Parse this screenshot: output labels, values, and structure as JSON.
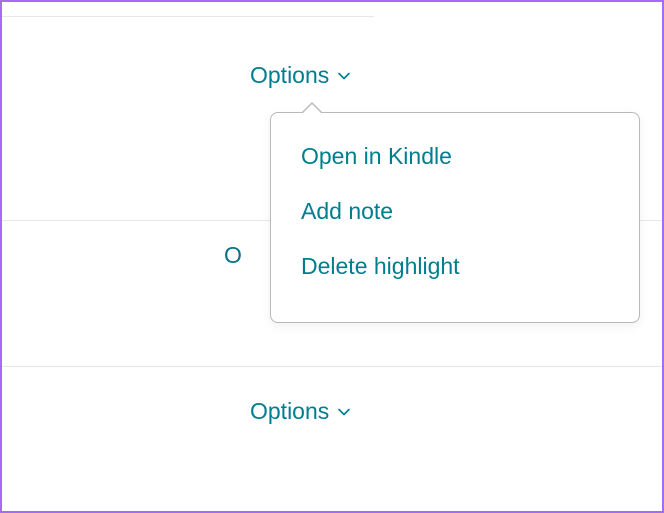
{
  "triggers": {
    "first": {
      "label": "Options"
    },
    "second": {
      "label": "Options"
    }
  },
  "hidden_trigger_initial": "O",
  "menu": {
    "items": [
      {
        "label": "Open in Kindle"
      },
      {
        "label": "Add note"
      },
      {
        "label": "Delete highlight"
      }
    ]
  }
}
